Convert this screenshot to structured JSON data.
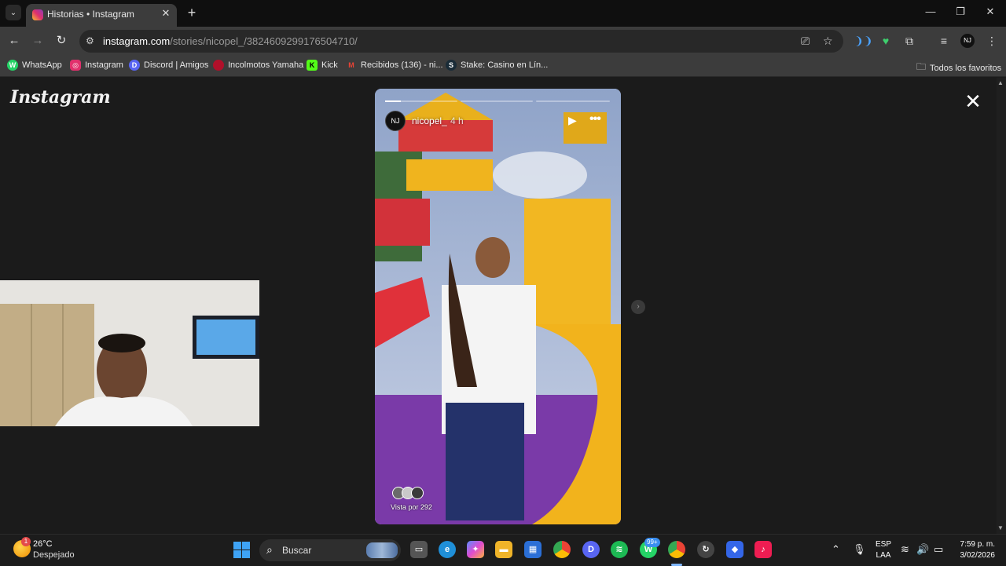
{
  "browser": {
    "tab": {
      "title": "Historias • Instagram"
    },
    "url": {
      "host": "instagram.com",
      "path": "/stories/nicopel_/3824609299176504710/"
    },
    "bookmarks": [
      {
        "label": "WhatsApp",
        "color": "#25d366",
        "glyph": "W"
      },
      {
        "label": "Instagram",
        "color": "#e1306c",
        "glyph": "◎"
      },
      {
        "label": "Discord | Amigos",
        "color": "#5865f2",
        "glyph": "D"
      },
      {
        "label": "Incolmotos Yamaha",
        "color": "#b0102a",
        "glyph": "Y"
      },
      {
        "label": "Kick",
        "color": "#53fc18",
        "glyph": "K"
      },
      {
        "label": "Recibidos (136) - ni...",
        "color": "#ea4335",
        "glyph": "M"
      },
      {
        "label": "Stake: Casino en Lín...",
        "color": "#1a2c38",
        "glyph": "S"
      }
    ],
    "all_bookmarks": "Todos los favoritos",
    "profile_initials": "NJ"
  },
  "instagram": {
    "logo": "Instagram",
    "story": {
      "username": "nicopel_",
      "time_ago": "4 h",
      "avatar_initials": "NJ",
      "viewed_by": "Vista por 292",
      "segments": 3,
      "current_segment_progress": 0.22
    }
  },
  "taskbar": {
    "weather": {
      "temp": "26°C",
      "condition": "Despejado",
      "badge": "1"
    },
    "search_label": "Buscar",
    "whatsapp_badge": "99+",
    "language": {
      "line1": "ESP",
      "line2": "LAA"
    },
    "clock": {
      "time": "7:59 p. m.",
      "date": "3/02/2026"
    }
  }
}
